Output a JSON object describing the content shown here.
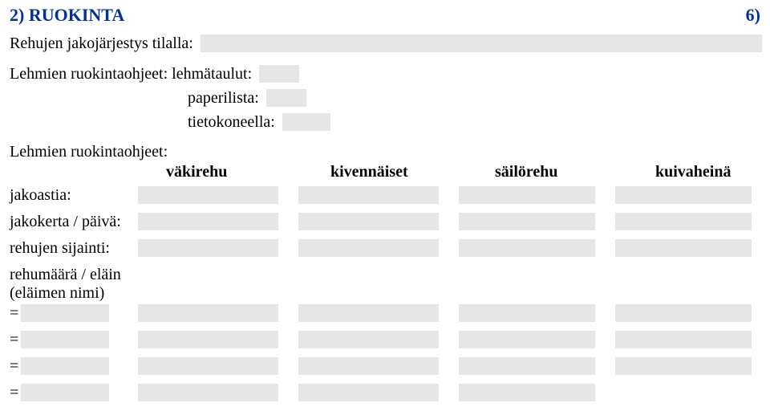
{
  "header": {
    "title": "2) RUOKINTA",
    "page_number": "6)"
  },
  "lines": {
    "rehujen_jako": "Rehujen jakojärjestys tilalla:",
    "lehmien_ohjeet_taulut": "Lehmien ruokintaohjeet: lehmätaulut:",
    "paperilista": "paperilista:",
    "tietokoneella": "tietokoneella:",
    "lehmien_ohjeet": "Lehmien ruokintaohjeet:"
  },
  "columns": {
    "c1": "väkirehu",
    "c2": "kivennäiset",
    "c3": "säilörehu",
    "c4": "kuivaheinä"
  },
  "rows": {
    "jakoastia": "jakoastia:",
    "jakokerta": "jakokerta / päivä:",
    "sijainti": "rehujen sijainti:",
    "rehumaara_l1": "rehumäärä / eläin",
    "rehumaara_l2": "(eläimen nimi)"
  },
  "eq": "="
}
